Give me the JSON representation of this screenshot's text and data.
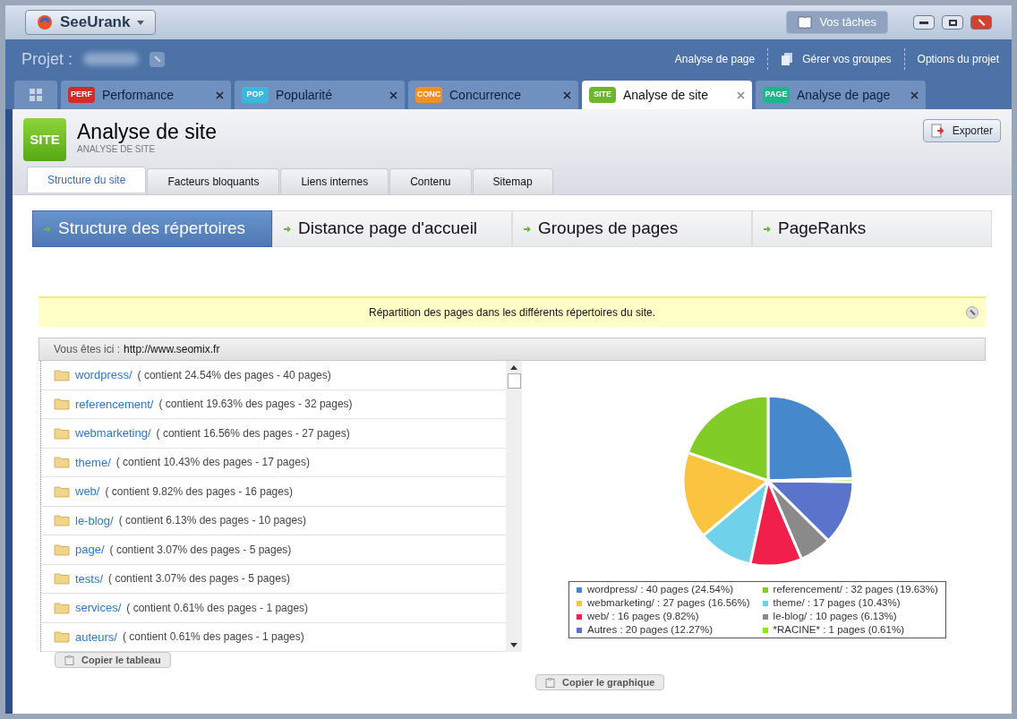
{
  "app_menu": {
    "label": "SeeUrank"
  },
  "tasks_button": {
    "label": "Vos tâches"
  },
  "project": {
    "label": "Projet :"
  },
  "project_links": [
    {
      "label": "Analyse de page",
      "kind": "plain"
    },
    {
      "label": "Gérer vos groupes",
      "kind": "icon"
    },
    {
      "label": "Options du projet",
      "kind": "plain"
    }
  ],
  "tabs": [
    {
      "badge": "PERF",
      "label": "Performance",
      "color": "#d42a2a",
      "selected": false
    },
    {
      "badge": "POP",
      "label": "Popularité",
      "color": "#3cb8e0",
      "selected": false
    },
    {
      "badge": "CONC",
      "label": "Concurrence",
      "color": "#f39020",
      "selected": false
    },
    {
      "badge": "SITE",
      "label": "Analyse de site",
      "color": "#6cb62a",
      "selected": true
    },
    {
      "badge": "PAGE",
      "label": "Analyse de page",
      "color": "#1fb58a",
      "selected": false
    }
  ],
  "page": {
    "badge": "SITE",
    "title": "Analyse de site",
    "subtitle": "ANALYSE DE SITE",
    "export": "Exporter"
  },
  "subtabs": [
    {
      "label": "Structure du site",
      "selected": true
    },
    {
      "label": "Facteurs bloquants",
      "selected": false
    },
    {
      "label": "Liens internes",
      "selected": false
    },
    {
      "label": "Contenu",
      "selected": false
    },
    {
      "label": "Sitemap",
      "selected": false
    }
  ],
  "sections": [
    {
      "label": "Structure des répertoires",
      "selected": true
    },
    {
      "label": "Distance page d'accueil",
      "selected": false
    },
    {
      "label": "Groupes de pages",
      "selected": false
    },
    {
      "label": "PageRanks",
      "selected": false
    }
  ],
  "notice": {
    "text": "Répartition des pages dans les différents répertoires du site."
  },
  "breadcrumb": {
    "label": "Vous êtes ici :",
    "url": "http://www.seomix.fr"
  },
  "folders": [
    {
      "name": "wordpress/",
      "detail": "( contient 24.54% des pages - 40 pages)"
    },
    {
      "name": "referencement/",
      "detail": "( contient 19.63% des pages - 32 pages)"
    },
    {
      "name": "webmarketing/",
      "detail": "( contient 16.56% des pages - 27 pages)"
    },
    {
      "name": "theme/",
      "detail": "( contient 10.43% des pages - 17 pages)"
    },
    {
      "name": "web/",
      "detail": "( contient 9.82% des pages - 16 pages)"
    },
    {
      "name": "le-blog/",
      "detail": "( contient 6.13% des pages - 10 pages)"
    },
    {
      "name": "page/",
      "detail": "( contient 3.07% des pages - 5 pages)"
    },
    {
      "name": "tests/",
      "detail": "( contient 3.07% des pages - 5 pages)"
    },
    {
      "name": "services/",
      "detail": "( contient 0.61% des pages - 1 pages)"
    },
    {
      "name": "auteurs/",
      "detail": "( contient 0.61% des pages - 1 pages)"
    }
  ],
  "copy_table": "Copier le tableau",
  "chart_data": {
    "type": "pie",
    "categories": [
      "wordpress/",
      "referencement/",
      "webmarketing/",
      "theme/",
      "web/",
      "le-blog/",
      "Autres",
      "*RACINE*"
    ],
    "values": [
      24.54,
      19.63,
      16.56,
      10.43,
      9.82,
      6.13,
      12.27,
      0.61
    ],
    "colors": [
      "#4589cc",
      "#82cc28",
      "#fbc440",
      "#70d2ea",
      "#f0204a",
      "#8a8a8a",
      "#5a74cc",
      "#88e818"
    ]
  },
  "legend": [
    {
      "detail": ":  40 pages (24.54%)"
    },
    {
      "detail": ":  32 pages (19.63%)"
    },
    {
      "detail": ":  27 pages (16.56%)"
    },
    {
      "detail": ":  17 pages (10.43%)"
    },
    {
      "detail": ":  16 pages (9.82%)"
    },
    {
      "detail": ":  10 pages (6.13%)"
    },
    {
      "detail": ":  20 pages (12.27%)"
    },
    {
      "detail": ":  1 pages (0.61%)"
    }
  ],
  "copy_chart": "Copier le graphique"
}
